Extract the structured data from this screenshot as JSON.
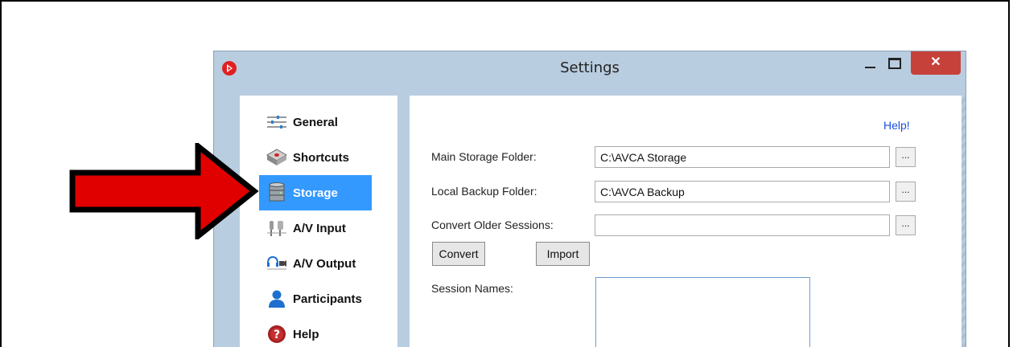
{
  "window": {
    "title": "Settings",
    "close_label": "✕"
  },
  "sidebar": {
    "items": [
      {
        "label": "General",
        "icon": "sliders-icon"
      },
      {
        "label": "Shortcuts",
        "icon": "keyboard-key-icon"
      },
      {
        "label": "Storage",
        "icon": "database-icon",
        "selected": true
      },
      {
        "label": "A/V Input",
        "icon": "audio-video-input-icon"
      },
      {
        "label": "A/V Output",
        "icon": "headphones-camera-icon"
      },
      {
        "label": "Participants",
        "icon": "person-icon"
      },
      {
        "label": "Help",
        "icon": "help-icon"
      }
    ]
  },
  "storage": {
    "help_link": "Help!",
    "main_folder_label": "Main Storage Folder:",
    "main_folder_value": "C:\\AVCA Storage",
    "backup_folder_label": "Local Backup Folder:",
    "backup_folder_value": "C:\\AVCA Backup",
    "convert_label": "Convert Older Sessions:",
    "convert_value": "",
    "browse_label": "...",
    "convert_button": "Convert",
    "import_button": "Import",
    "session_names_label": "Session Names:"
  },
  "colors": {
    "selected": "#3399ff",
    "arrow": "#e00000",
    "close": "#c7413b"
  }
}
